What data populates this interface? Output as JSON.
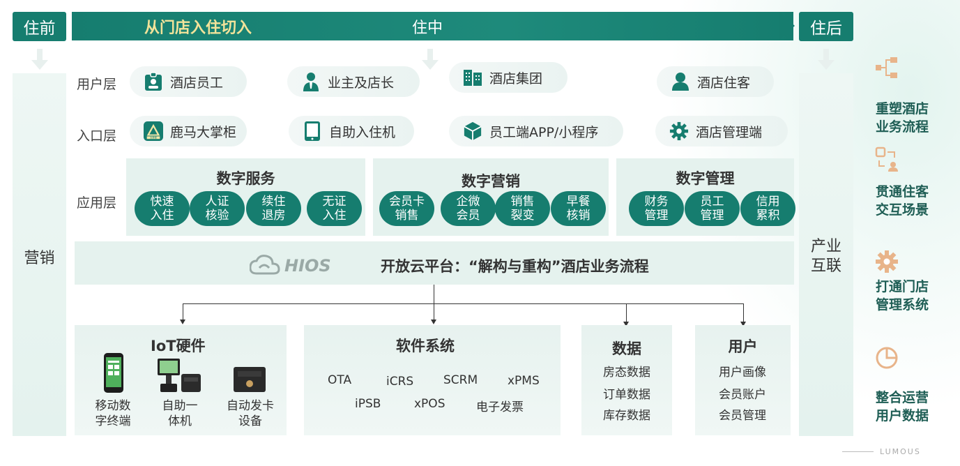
{
  "phases": {
    "before": "住前",
    "during": "住中",
    "after": "住后"
  },
  "bar_slogan": "从门店入住切入",
  "side": {
    "left": "营销",
    "right": "产业\n互联"
  },
  "layers": {
    "user": "用户层",
    "entry": "入口层",
    "app": "应用层"
  },
  "user_layer": [
    "酒店员工",
    "业主及店长",
    "酒店集团",
    "酒店住客"
  ],
  "entry_layer": [
    "鹿马大掌柜",
    "自助入住机",
    "员工端APP/小程序",
    "酒店管理端"
  ],
  "logo_mini_text": "大掌柜",
  "app_groups": [
    {
      "title": "数字服务",
      "items": [
        "快速\n入住",
        "人证\n核验",
        "续住\n退房",
        "无证\n入住"
      ]
    },
    {
      "title": "数字营销",
      "items": [
        "会员卡\n销售",
        "企微\n会员",
        "销售\n裂变",
        "早餐\n核销"
      ]
    },
    {
      "title": "数字管理",
      "items": [
        "财务\n管理",
        "员工\n管理",
        "信用\n累积"
      ]
    }
  ],
  "platform": {
    "logo": "HIOS",
    "text": "开放云平台：“解构与重构”酒店业务流程"
  },
  "iot": {
    "title": "IoT硬件",
    "items": [
      "移动数\n字终端",
      "自助一\n体机",
      "自动发卡\n设备"
    ]
  },
  "software": {
    "title": "软件系统",
    "row1": [
      "OTA",
      "iCRS",
      "SCRM",
      "xPMS"
    ],
    "row2": [
      "iPSB",
      "xPOS",
      "电子发票"
    ]
  },
  "data_panel": {
    "title": "数据",
    "items": [
      "房态数据",
      "订单数据",
      "库存数据"
    ]
  },
  "user_panel": {
    "title": "用户",
    "items": [
      "用户画像",
      "会员账户",
      "会员管理"
    ]
  },
  "benefits": [
    "重塑酒店\n业务流程",
    "贯通住客\n交互场景",
    "打通门店\n管理系统",
    "整合运营\n用户数据"
  ],
  "brand": "LUMOUS",
  "colors": {
    "primary": "#167d6f",
    "panel": "#e5f2ee",
    "accent_text": "#f2e39a",
    "icon_light": "#e8b48a"
  }
}
